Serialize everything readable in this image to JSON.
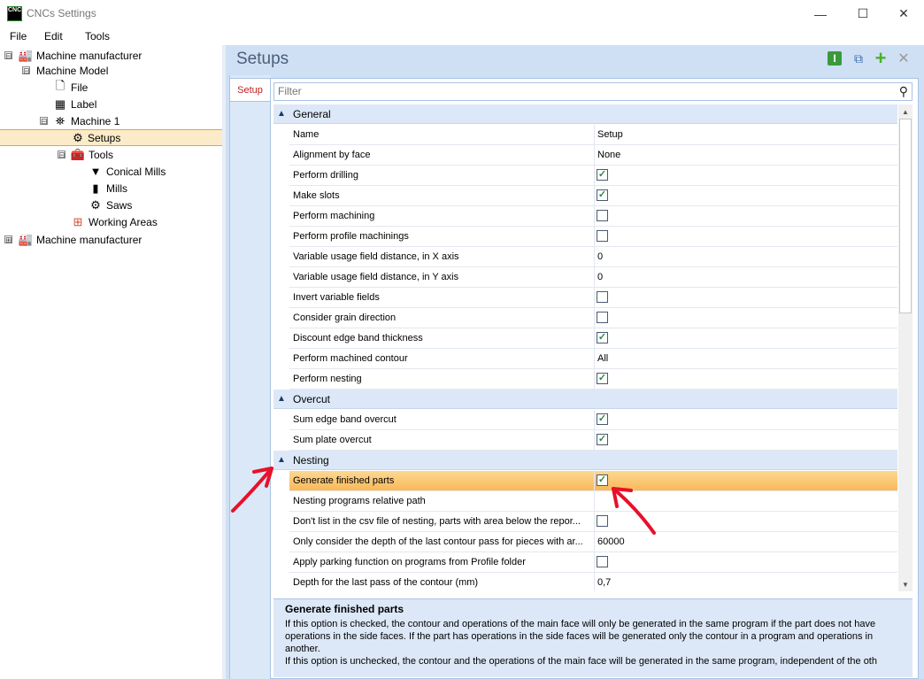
{
  "window": {
    "title": "CNCs Settings",
    "icon_text": "CNC",
    "minimize": "—",
    "maximize": "☐",
    "close": "✕"
  },
  "menu": [
    "File",
    "Edit",
    "Tools"
  ],
  "tree": [
    {
      "label": "Machine manufacturer",
      "expander": "⊟",
      "icon": "factory-icon"
    },
    {
      "label": "Machine Model",
      "expander": "⊟",
      "icon": ""
    },
    {
      "label": "File",
      "expander": "",
      "icon": "file-icon"
    },
    {
      "label": "Label",
      "expander": "",
      "icon": "label-icon"
    },
    {
      "label": "Machine 1",
      "expander": "⊟",
      "icon": "machine-icon"
    },
    {
      "label": "Setups",
      "expander": "",
      "icon": "gear-icon"
    },
    {
      "label": "Tools",
      "expander": "⊟",
      "icon": "toolbox-icon"
    },
    {
      "label": "Conical Mills",
      "expander": "",
      "icon": "conical-mill-icon"
    },
    {
      "label": "Mills",
      "expander": "",
      "icon": "mill-icon"
    },
    {
      "label": "Saws",
      "expander": "",
      "icon": "saw-icon"
    },
    {
      "label": "Working Areas",
      "expander": "",
      "icon": "working-areas-icon"
    },
    {
      "label": "Machine manufacturer",
      "expander": "⊞",
      "icon": "factory-icon"
    }
  ],
  "panel": {
    "title": "Setups",
    "tab": "Setup",
    "filter_placeholder": "Filter"
  },
  "categories": {
    "general": "General",
    "overcut": "Overcut",
    "nesting": "Nesting"
  },
  "general_rows": [
    {
      "name": "Name",
      "value": "Setup"
    },
    {
      "name": "Alignment by face",
      "value": "None"
    },
    {
      "name": "Perform drilling",
      "check": "✓"
    },
    {
      "name": "Make slots",
      "check": "✓"
    },
    {
      "name": "Perform machining",
      "check": ""
    },
    {
      "name": "Perform profile machinings",
      "check": ""
    },
    {
      "name": "Variable usage field distance, in X axis",
      "value": "0"
    },
    {
      "name": "Variable usage field distance, in Y axis",
      "value": "0"
    },
    {
      "name": "Invert variable fields",
      "check": ""
    },
    {
      "name": "Consider grain direction",
      "check": ""
    },
    {
      "name": "Discount edge band thickness",
      "check": "✓"
    },
    {
      "name": "Perform machined contour",
      "value": "All"
    },
    {
      "name": "Perform nesting",
      "check": "✓"
    }
  ],
  "overcut_rows": [
    {
      "name": "Sum edge band overcut",
      "check": "✓"
    },
    {
      "name": "Sum plate overcut",
      "check": "✓"
    }
  ],
  "nesting_rows": [
    {
      "name": "Generate finished parts",
      "check": "✓"
    },
    {
      "name": "Nesting programs relative path",
      "value": ""
    },
    {
      "name": "Don't list in the csv file of nesting, parts with area below the repor...",
      "check": ""
    },
    {
      "name": "Only consider the depth of the last contour pass for pieces with ar...",
      "value": "60000"
    },
    {
      "name": "Apply parking function on programs from Profile folder",
      "check": ""
    },
    {
      "name": "Depth for the last pass of the contour (mm)",
      "value": "0,7"
    }
  ],
  "description": {
    "title": "Generate finished parts",
    "line1": "If this option is checked, the contour and operations of the main face will only be generated in the same program if the part does not have operations in the side faces. If the part has operations in the side faces will be generated only the contour in a program and operations in another.",
    "line2": "If this option is unchecked, the contour and the operations of the main face will be generated in the same program, independent of the oth"
  },
  "colors": {
    "accent_selected": "#f9b95a",
    "annotation_arrow": "#e8102a"
  }
}
